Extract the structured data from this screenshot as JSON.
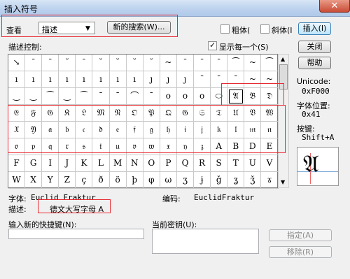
{
  "window": {
    "title": "插入符号",
    "close_glyph": "✕"
  },
  "toolbar": {
    "view_label": "查看",
    "view_value": "描述",
    "new_search_label": "新的搜索(W)...",
    "bold_label": "粗体(",
    "italic_label": "斜体(I",
    "insert_label": "插入(I)"
  },
  "left": {
    "desc_control_label": "描述控制:"
  },
  "show_each_label": "显示每一个(S)",
  "buttons": {
    "close": "关闭",
    "help": "帮助",
    "assign": "指定(A)",
    "remove": "移除(R)"
  },
  "info": {
    "unicode_label": "Unicode:",
    "unicode_value": "0xF000",
    "font_pos_label": "字体位置:",
    "font_pos_value": "0x41",
    "key_label": "按键:",
    "key_value": "Shift+A",
    "preview_glyph": "𝔄"
  },
  "details": {
    "font_label": "字体:",
    "font_value": "Euclid Fraktur",
    "encoding_label": "编码:",
    "encoding_value": "EuclidFraktur",
    "desc_label": "描述:",
    "desc_value": "德文大写字母 A"
  },
  "shortcut": {
    "new_label": "输入新的快捷键(N):",
    "current_label": "当前密钥(U):"
  },
  "grid": {
    "rows": [
      [
        "↘",
        "ˉ",
        "ˉ",
        "˘",
        "ˉ",
        "˘",
        "˘",
        "˘",
        "˘",
        "~",
        "ˉ",
        "ˉ",
        "ˉ",
        "⁀",
        "~",
        "⁀"
      ],
      [
        "ı",
        "ı",
        "ı",
        "ı",
        "ı",
        "ı",
        "ı",
        "ı",
        "ȷ",
        "ȷ",
        "ȷ",
        "ˉ",
        "ˉ",
        "ˉ",
        "~",
        "~"
      ],
      [
        "‿",
        "‿",
        "⁀",
        "‿",
        "⁀",
        "ˉ",
        "ˉ",
        "⌒",
        "ˉ",
        "o",
        "o",
        "o",
        "⬭",
        "𝔄",
        "𝔅",
        "𝔇"
      ],
      [
        "𝔈",
        "𝔉",
        "𝔊",
        "𝔎",
        "𝔏",
        "𝔐",
        "𝔑",
        "𝔒",
        "𝔓",
        "𝔔",
        "𝔊",
        "𝔖",
        "𝔗",
        "𝔘",
        "𝔙",
        "𝔚"
      ],
      [
        "𝔛",
        "𝔜",
        "𝔞",
        "𝔟",
        "𝔠",
        "𝔡",
        "𝔢",
        "𝔣",
        "𝔤",
        "𝔥",
        "𝔦",
        "𝔧",
        "𝔨",
        "𝔩",
        "𝔪",
        "𝔫"
      ],
      [
        "𝔬",
        "𝔭",
        "𝔮",
        "𝔯",
        "𝔰",
        "𝔱",
        "𝔲",
        "𝔳",
        "𝔴",
        "𝔵",
        "𝔶",
        "𝔷",
        "A",
        "B",
        "D",
        "E"
      ],
      [
        "F",
        "G",
        "I",
        "J",
        "K",
        "L",
        "M",
        "N",
        "O",
        "P",
        "Q",
        "R",
        "S",
        "T",
        "U",
        "V"
      ],
      [
        "W",
        "X",
        "Y",
        "Z",
        "ç",
        "ð",
        "ö",
        "þ",
        "φ",
        "ω",
        "ʒ",
        "ɉ",
        "ǧ",
        "ʓ",
        "ǯ",
        "ɤ"
      ]
    ]
  }
}
